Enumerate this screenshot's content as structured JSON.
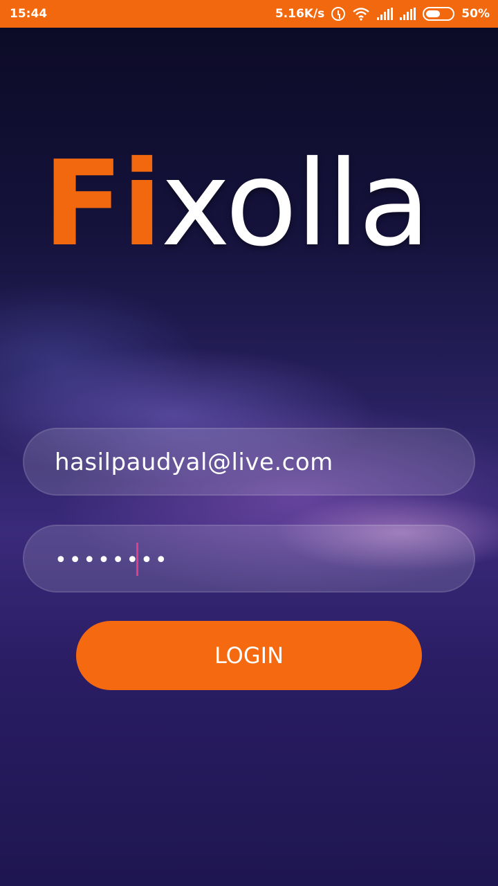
{
  "status_bar": {
    "time": "15:44",
    "network_speed": "5.16K/s",
    "battery": "50%",
    "icons": [
      "alarm-icon",
      "wifi-icon",
      "signal-icon",
      "signal-icon",
      "battery-icon"
    ]
  },
  "logo": {
    "part1": "Fi",
    "part2": "xolla",
    "colors": {
      "accent": "#f2680f",
      "main": "#ffffff"
    }
  },
  "form": {
    "email_value": "hasilpaudyal@live.com",
    "password_mask": "••••••••"
  },
  "login_button": {
    "label": "LOGIN",
    "color": "#f56a10"
  }
}
